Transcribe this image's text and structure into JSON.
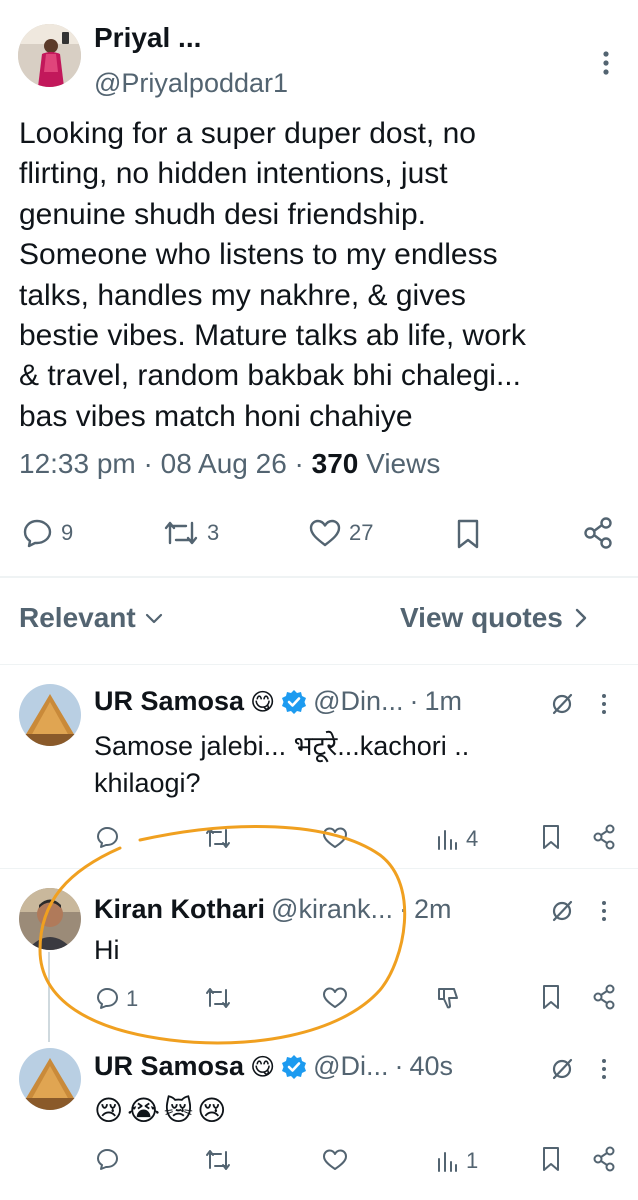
{
  "main_tweet": {
    "author_name": "Priyal ...",
    "author_handle": "@Priyalpoddar1",
    "text": "Looking for a super duper dost, no\nflirting, no hidden intentions, just\ngenuine shudh desi friendship.\nSomeone who listens to my endless\ntalks, handles my nakhre, & gives\nbestie vibes. Mature talks ab life, work\n& travel, random bakbak bhi chalegi...\nbas vibes match honi chahiye",
    "time": "12:33 pm",
    "date": "08 Aug 26",
    "views_count": "370",
    "views_label": "Views",
    "replies": "9",
    "reposts": "3",
    "likes": "27"
  },
  "sort": {
    "label": "Relevant",
    "quotes_label": "View quotes"
  },
  "replies": [
    {
      "name": "UR Samosa",
      "emoji": "😋",
      "handle": "@Din...",
      "time": "1m",
      "text": "Samose jalebi... भटूरे...kachori ..\nkhilaogi?",
      "views": "4"
    },
    {
      "name": "Kiran Kothari",
      "handle": "@kirank...",
      "time": "2m",
      "text": "Hi",
      "replies": "1"
    },
    {
      "name": "UR Samosa",
      "emoji": "😋",
      "handle": "@Di...",
      "time": "40s",
      "text": "😢😭😿😢",
      "views": "1"
    }
  ],
  "colors": {
    "text_primary": "#0f1419",
    "text_secondary": "#536471",
    "verified_blue": "#1d9bf0",
    "annotation_orange": "#f0a020",
    "divider": "#eff3f4"
  }
}
